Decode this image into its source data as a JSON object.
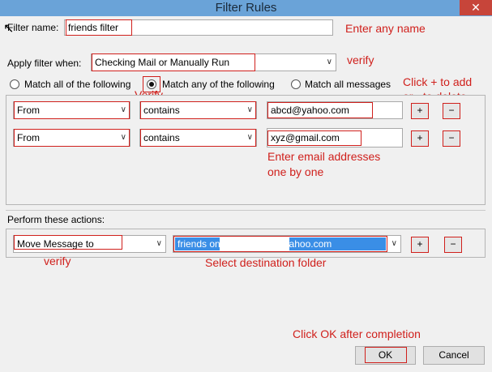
{
  "window": {
    "title": "Filter Rules",
    "close_glyph": "✕"
  },
  "filter_name": {
    "label": "Filter name:",
    "value": "friends filter"
  },
  "apply_when": {
    "label": "Apply filter when:",
    "value": "Checking Mail or Manually Run"
  },
  "match": {
    "options": [
      "Match all of the following",
      "Match any of the following",
      "Match all messages"
    ],
    "selected": "Match any of the following"
  },
  "rules": [
    {
      "field": "From",
      "operator": "contains",
      "value": "abcd@yahoo.com",
      "add": "+",
      "remove": "−"
    },
    {
      "field": "From",
      "operator": "contains",
      "value": "xyz@gmail.com",
      "add": "+",
      "remove": "−"
    }
  ],
  "actions": {
    "label": "Perform these actions:",
    "action": "Move Message to",
    "folder": "friends on                    @yahoo.com",
    "add": "+",
    "remove": "−"
  },
  "buttons": {
    "ok": "OK",
    "cancel": "Cancel"
  },
  "annotations": {
    "enter_name": "Enter any name",
    "verify_1": "verify",
    "verify_2": "Verify",
    "click_plus": "Click + to add",
    "or_minus": "or - to delete",
    "enter_emails_1": "Enter email addresses",
    "enter_emails_2": "one by one",
    "verify_3": "verify",
    "select_folder": "Select destination folder",
    "click_ok": "Click OK after completion"
  },
  "colors": {
    "annotation": "#d0201c",
    "titlebar": "#6aa3d8",
    "selection": "#3a8ee6"
  },
  "icons": [
    "close-icon",
    "dropdown-arrow-icon",
    "cursor-icon"
  ]
}
